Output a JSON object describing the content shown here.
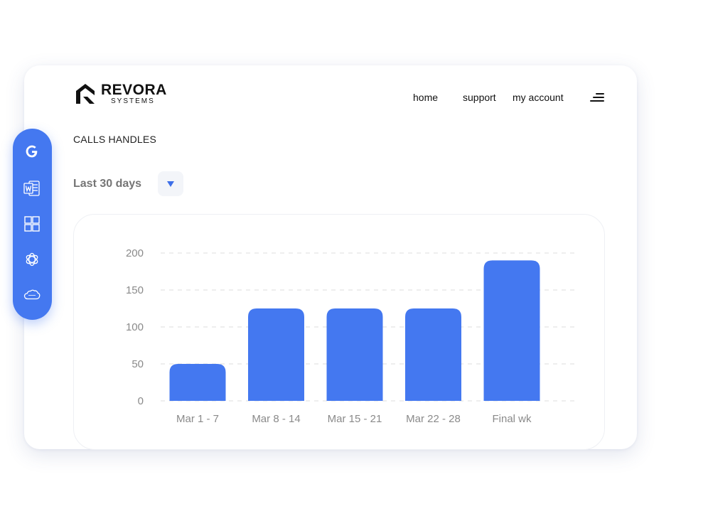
{
  "header": {
    "brand_main": "REVORA",
    "brand_sub": "SYSTEMS",
    "nav": [
      {
        "label": "home"
      },
      {
        "label": "support"
      },
      {
        "label": "my account"
      }
    ],
    "menu_icon": "hamburger-menu-icon"
  },
  "section_title": "CALLS HANDLES",
  "range": {
    "label": "Last 30 days",
    "dropdown_icon": "triangle-down-icon"
  },
  "sidebar": {
    "items": [
      {
        "icon": "google-icon"
      },
      {
        "icon": "word-document-icon"
      },
      {
        "icon": "grid-apps-icon"
      },
      {
        "icon": "openai-icon"
      },
      {
        "icon": "salesforce-cloud-icon"
      }
    ]
  },
  "colors": {
    "accent": "#4478f0",
    "bar": "#4478f0",
    "axis_text": "#8a8a8a",
    "grid": "#dcdcdc"
  },
  "chart_data": {
    "type": "bar",
    "title": "",
    "xlabel": "",
    "ylabel": "",
    "categories": [
      "Mar 1 - 7",
      "Mar 8 - 14",
      "Mar 15 - 21",
      "Mar 22 - 28",
      "Final wk"
    ],
    "values": [
      50,
      125,
      125,
      125,
      190
    ],
    "yticks": [
      0,
      50,
      100,
      150,
      200
    ],
    "ylim": [
      0,
      200
    ],
    "grid": "horizontal-dashed",
    "legend": "none"
  }
}
